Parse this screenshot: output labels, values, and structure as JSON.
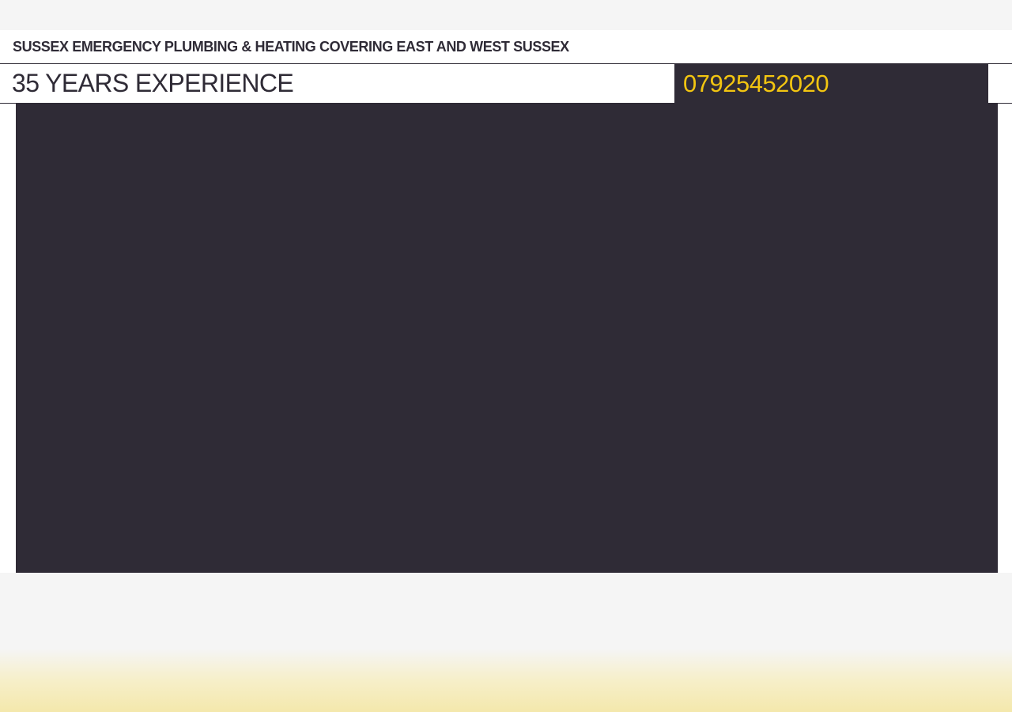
{
  "site": {
    "tagline": "SUSSEX EMERGENCY PLUMBING & HEATING COVERING EAST AND WEST SUSSEX",
    "experience": "35 YEARS EXPERIENCE",
    "phone": "07925452020"
  },
  "colors": {
    "dark": "#2f2b36",
    "accent": "#f2c511",
    "background": "#f5f5f5",
    "white": "#ffffff",
    "bottom_gradient": "#f4e8ac"
  }
}
